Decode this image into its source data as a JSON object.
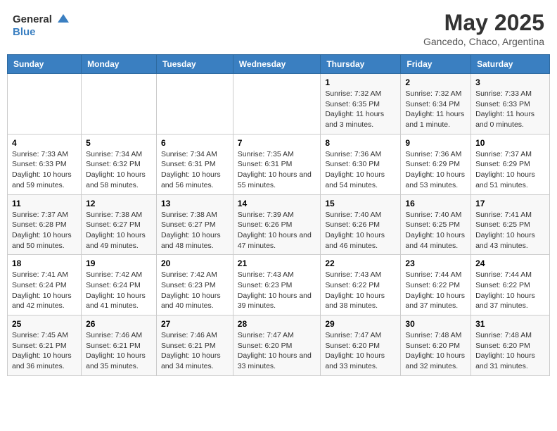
{
  "header": {
    "logo_general": "General",
    "logo_blue": "Blue",
    "title": "May 2025",
    "subtitle": "Gancedo, Chaco, Argentina"
  },
  "days_of_week": [
    "Sunday",
    "Monday",
    "Tuesday",
    "Wednesday",
    "Thursday",
    "Friday",
    "Saturday"
  ],
  "weeks": [
    [
      {
        "day": "",
        "info": ""
      },
      {
        "day": "",
        "info": ""
      },
      {
        "day": "",
        "info": ""
      },
      {
        "day": "",
        "info": ""
      },
      {
        "day": "1",
        "info": "Sunrise: 7:32 AM\nSunset: 6:35 PM\nDaylight: 11 hours\nand 3 minutes."
      },
      {
        "day": "2",
        "info": "Sunrise: 7:32 AM\nSunset: 6:34 PM\nDaylight: 11 hours\nand 1 minute."
      },
      {
        "day": "3",
        "info": "Sunrise: 7:33 AM\nSunset: 6:33 PM\nDaylight: 11 hours\nand 0 minutes."
      }
    ],
    [
      {
        "day": "4",
        "info": "Sunrise: 7:33 AM\nSunset: 6:33 PM\nDaylight: 10 hours\nand 59 minutes."
      },
      {
        "day": "5",
        "info": "Sunrise: 7:34 AM\nSunset: 6:32 PM\nDaylight: 10 hours\nand 58 minutes."
      },
      {
        "day": "6",
        "info": "Sunrise: 7:34 AM\nSunset: 6:31 PM\nDaylight: 10 hours\nand 56 minutes."
      },
      {
        "day": "7",
        "info": "Sunrise: 7:35 AM\nSunset: 6:31 PM\nDaylight: 10 hours\nand 55 minutes."
      },
      {
        "day": "8",
        "info": "Sunrise: 7:36 AM\nSunset: 6:30 PM\nDaylight: 10 hours\nand 54 minutes."
      },
      {
        "day": "9",
        "info": "Sunrise: 7:36 AM\nSunset: 6:29 PM\nDaylight: 10 hours\nand 53 minutes."
      },
      {
        "day": "10",
        "info": "Sunrise: 7:37 AM\nSunset: 6:29 PM\nDaylight: 10 hours\nand 51 minutes."
      }
    ],
    [
      {
        "day": "11",
        "info": "Sunrise: 7:37 AM\nSunset: 6:28 PM\nDaylight: 10 hours\nand 50 minutes."
      },
      {
        "day": "12",
        "info": "Sunrise: 7:38 AM\nSunset: 6:27 PM\nDaylight: 10 hours\nand 49 minutes."
      },
      {
        "day": "13",
        "info": "Sunrise: 7:38 AM\nSunset: 6:27 PM\nDaylight: 10 hours\nand 48 minutes."
      },
      {
        "day": "14",
        "info": "Sunrise: 7:39 AM\nSunset: 6:26 PM\nDaylight: 10 hours\nand 47 minutes."
      },
      {
        "day": "15",
        "info": "Sunrise: 7:40 AM\nSunset: 6:26 PM\nDaylight: 10 hours\nand 46 minutes."
      },
      {
        "day": "16",
        "info": "Sunrise: 7:40 AM\nSunset: 6:25 PM\nDaylight: 10 hours\nand 44 minutes."
      },
      {
        "day": "17",
        "info": "Sunrise: 7:41 AM\nSunset: 6:25 PM\nDaylight: 10 hours\nand 43 minutes."
      }
    ],
    [
      {
        "day": "18",
        "info": "Sunrise: 7:41 AM\nSunset: 6:24 PM\nDaylight: 10 hours\nand 42 minutes."
      },
      {
        "day": "19",
        "info": "Sunrise: 7:42 AM\nSunset: 6:24 PM\nDaylight: 10 hours\nand 41 minutes."
      },
      {
        "day": "20",
        "info": "Sunrise: 7:42 AM\nSunset: 6:23 PM\nDaylight: 10 hours\nand 40 minutes."
      },
      {
        "day": "21",
        "info": "Sunrise: 7:43 AM\nSunset: 6:23 PM\nDaylight: 10 hours\nand 39 minutes."
      },
      {
        "day": "22",
        "info": "Sunrise: 7:43 AM\nSunset: 6:22 PM\nDaylight: 10 hours\nand 38 minutes."
      },
      {
        "day": "23",
        "info": "Sunrise: 7:44 AM\nSunset: 6:22 PM\nDaylight: 10 hours\nand 37 minutes."
      },
      {
        "day": "24",
        "info": "Sunrise: 7:44 AM\nSunset: 6:22 PM\nDaylight: 10 hours\nand 37 minutes."
      }
    ],
    [
      {
        "day": "25",
        "info": "Sunrise: 7:45 AM\nSunset: 6:21 PM\nDaylight: 10 hours\nand 36 minutes."
      },
      {
        "day": "26",
        "info": "Sunrise: 7:46 AM\nSunset: 6:21 PM\nDaylight: 10 hours\nand 35 minutes."
      },
      {
        "day": "27",
        "info": "Sunrise: 7:46 AM\nSunset: 6:21 PM\nDaylight: 10 hours\nand 34 minutes."
      },
      {
        "day": "28",
        "info": "Sunrise: 7:47 AM\nSunset: 6:20 PM\nDaylight: 10 hours\nand 33 minutes."
      },
      {
        "day": "29",
        "info": "Sunrise: 7:47 AM\nSunset: 6:20 PM\nDaylight: 10 hours\nand 33 minutes."
      },
      {
        "day": "30",
        "info": "Sunrise: 7:48 AM\nSunset: 6:20 PM\nDaylight: 10 hours\nand 32 minutes."
      },
      {
        "day": "31",
        "info": "Sunrise: 7:48 AM\nSunset: 6:20 PM\nDaylight: 10 hours\nand 31 minutes."
      }
    ]
  ]
}
